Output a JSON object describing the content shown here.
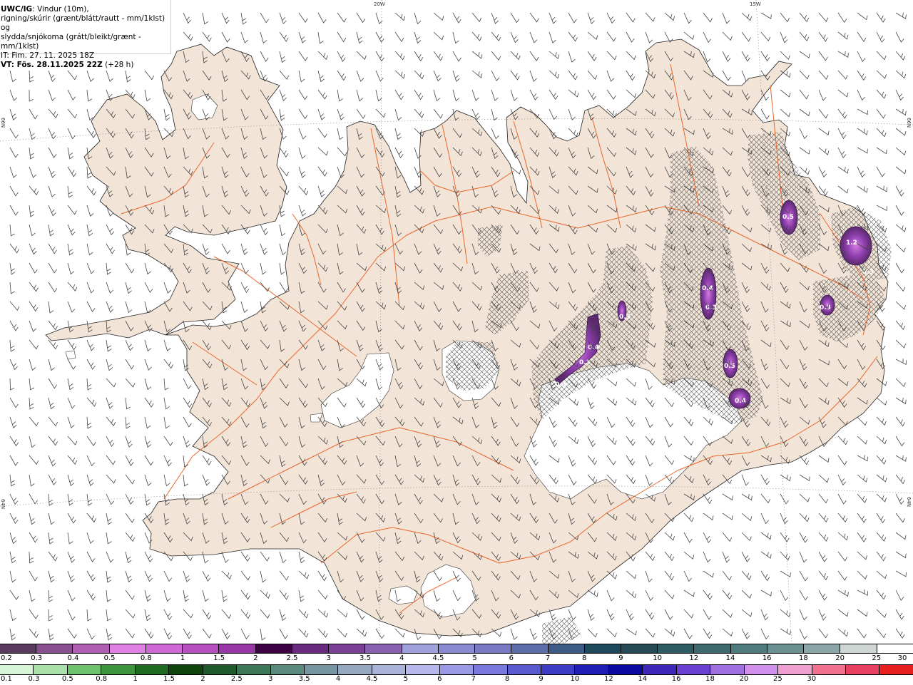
{
  "title": {
    "prefix": "UWC/IG",
    "line1": ": Vindur (10m),",
    "line2": "rigning/skúrir (grænt/blátt/rautt - mm/1klst) og",
    "line3": "slydda/snjókoma (grátt/bleikt/grænt - mm/1klst)",
    "init_time": "IT: Fim. 27. 11. 2025 18Z",
    "valid_time": "VT: Fös. 28.11.2025 22Z",
    "lead": " (+28 h)"
  },
  "graticule": {
    "lon_labels": [
      "20W",
      "15W"
    ],
    "lat_labels": [
      "66N",
      "64N"
    ]
  },
  "colors": {
    "land": "#f2e4d6",
    "glacier": "#ffffff",
    "roads": "#e8672e",
    "coast": "#222222",
    "precip_dark": "#5b2a6e",
    "precip_mid": "#8f3fae",
    "precip_light": "#cc66dd"
  },
  "precip_labels": [
    {
      "id": "a",
      "value": "1.2"
    },
    {
      "id": "b",
      "value": "0.3"
    },
    {
      "id": "c",
      "value": "0.5"
    },
    {
      "id": "d",
      "value": "0.4"
    },
    {
      "id": "e",
      "value": "0.3"
    },
    {
      "id": "f",
      "value": "0.3"
    },
    {
      "id": "g",
      "value": "0.5"
    },
    {
      "id": "h",
      "value": "0.4"
    },
    {
      "id": "i",
      "value": "0.4"
    },
    {
      "id": "j",
      "value": "0.3"
    },
    {
      "id": "k",
      "value": "0.3"
    },
    {
      "id": "l",
      "value": "0.3"
    }
  ],
  "legend_snow": {
    "colors": [
      "#5a3a5e",
      "#8a4f8e",
      "#b05eb4",
      "#e080e4",
      "#d069d6",
      "#b84fc0",
      "#9a37a8",
      "#3e0044",
      "#6a2a80",
      "#7a4096",
      "#8a60b0",
      "#a0a0dc",
      "#8a8ad0",
      "#7a7ac4",
      "#5c6eaa",
      "#3e5a86",
      "#1e4a5e",
      "#264a56",
      "#2e5c64",
      "#3c6a6e",
      "#4e7c7e",
      "#6a9090",
      "#8aa6a6",
      "#cfd6d4",
      "#ffffff"
    ],
    "ticks": [
      "0.2",
      "0.3",
      "0.4",
      "0.5",
      "0.8",
      "1",
      "1.5",
      "2",
      "2.5",
      "3",
      "3.5",
      "4",
      "4.5",
      "5",
      "6",
      "7",
      "8",
      "9",
      "10",
      "12",
      "14",
      "16",
      "18",
      "20",
      "25",
      "30"
    ]
  },
  "legend_rain": {
    "colors": [
      "#d6f5d6",
      "#aae0aa",
      "#6ec26e",
      "#3c943c",
      "#1e6a1e",
      "#0c440c",
      "#1e5a2a",
      "#3c7858",
      "#5a8a7e",
      "#7896a2",
      "#96a8c0",
      "#aab4d8",
      "#b8b8ee",
      "#9a9ae6",
      "#7a7ade",
      "#5a5ad0",
      "#3c3cc4",
      "#1e1eb4",
      "#0a0aa0",
      "#3e26b8",
      "#6a40d0",
      "#a070e0",
      "#d090ec",
      "#f0a0d0",
      "#f07090",
      "#e84060",
      "#e82020"
    ],
    "ticks": [
      "0.1",
      "0.3",
      "0.5",
      "0.8",
      "1",
      "1.5",
      "2",
      "2.5",
      "3",
      "3.5",
      "4",
      "4.5",
      "5",
      "6",
      "7",
      "8",
      "9",
      "10",
      "12",
      "14",
      "16",
      "18",
      "20",
      "25",
      "30"
    ]
  }
}
